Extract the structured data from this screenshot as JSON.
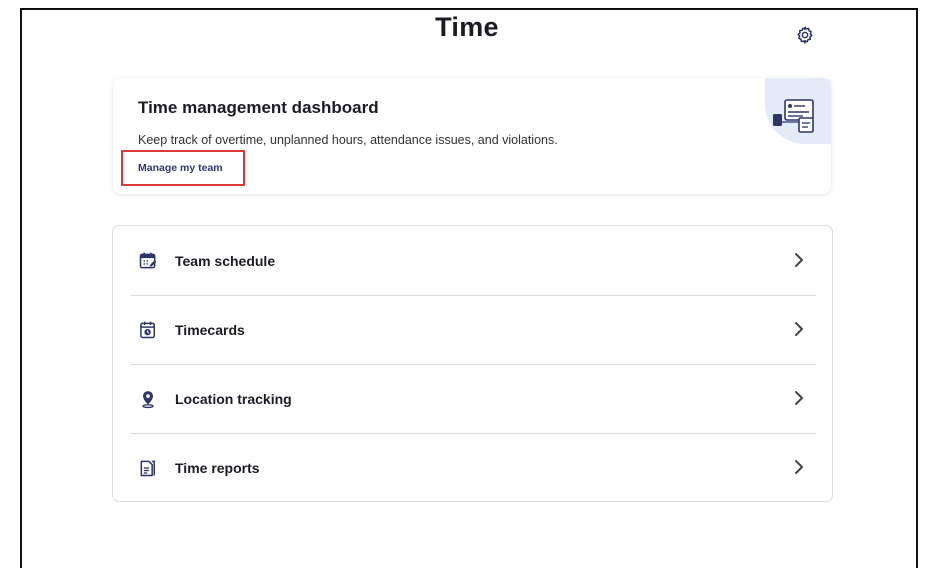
{
  "header": {
    "title": "Time",
    "settings_icon": "gear-icon"
  },
  "dashboard_card": {
    "title": "Time management dashboard",
    "description": "Keep track of overtime, unplanned hours, attendance issues, and violations.",
    "link_label": "Manage my team",
    "illustration": "dashboard-illustration-icon"
  },
  "menu": {
    "items": [
      {
        "label": "Team schedule",
        "icon": "calendar-edit-icon"
      },
      {
        "label": "Timecards",
        "icon": "timecard-clock-icon"
      },
      {
        "label": "Location tracking",
        "icon": "location-pin-icon"
      },
      {
        "label": "Time reports",
        "icon": "report-document-icon"
      }
    ]
  },
  "colors": {
    "accent": "#2f3a74",
    "icon": "#2d3767",
    "highlight_border": "#d93a3a",
    "illustration_bg": "#e4ebf8"
  }
}
